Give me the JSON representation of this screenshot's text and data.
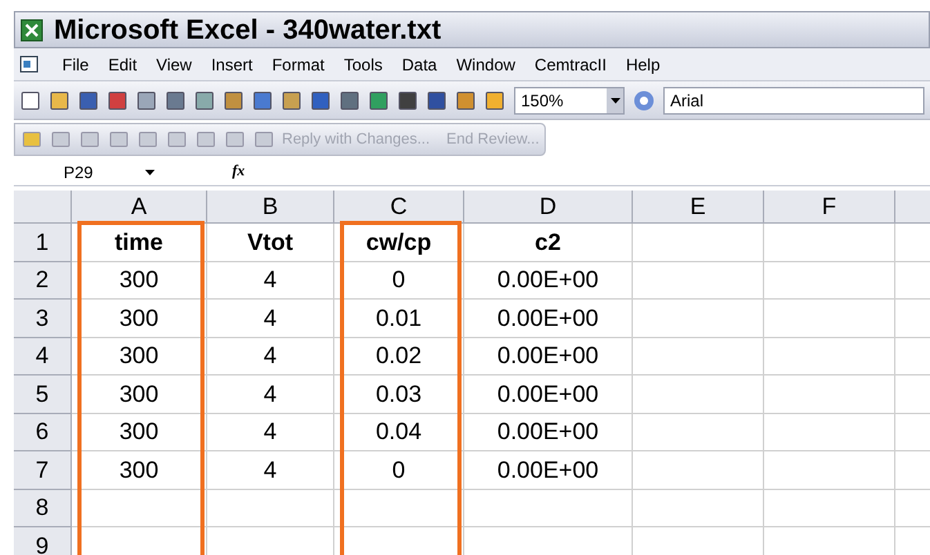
{
  "window": {
    "title": "Microsoft Excel - 340water.txt"
  },
  "menu": [
    "File",
    "Edit",
    "View",
    "Insert",
    "Format",
    "Tools",
    "Data",
    "Window",
    "CemtracII",
    "Help"
  ],
  "toolbar": {
    "zoom": "150%",
    "font": "Arial"
  },
  "review_toolbar": {
    "buttons": [
      {
        "label": "Reply with Changes...",
        "disabled": true
      },
      {
        "label": "End Review...",
        "disabled": true
      }
    ]
  },
  "name_box": "P29",
  "formula_bar": {
    "label": "fx"
  },
  "sheet": {
    "columns": [
      {
        "label": "A",
        "highlighted": true
      },
      {
        "label": "B",
        "highlighted": false
      },
      {
        "label": "C",
        "highlighted": true
      },
      {
        "label": "D",
        "highlighted": false
      },
      {
        "label": "E",
        "highlighted": false
      },
      {
        "label": "F",
        "highlighted": false
      }
    ],
    "rows": [
      {
        "label": "1",
        "cells": [
          "time",
          "Vtot",
          "cw/cp",
          "c2"
        ]
      },
      {
        "label": "2",
        "cells": [
          "300",
          "4",
          "0",
          "0.00E+00"
        ]
      },
      {
        "label": "3",
        "cells": [
          "300",
          "4",
          "0.01",
          "0.00E+00"
        ]
      },
      {
        "label": "4",
        "cells": [
          "300",
          "4",
          "0.02",
          "0.00E+00"
        ]
      },
      {
        "label": "5",
        "cells": [
          "300",
          "4",
          "0.03",
          "0.00E+00"
        ]
      },
      {
        "label": "6",
        "cells": [
          "300",
          "4",
          "0.04",
          "0.00E+00"
        ]
      },
      {
        "label": "7",
        "cells": [
          "300",
          "4",
          "0",
          "0.00E+00"
        ]
      },
      {
        "label": "8",
        "cells": []
      },
      {
        "label": "9",
        "cells": []
      }
    ]
  }
}
